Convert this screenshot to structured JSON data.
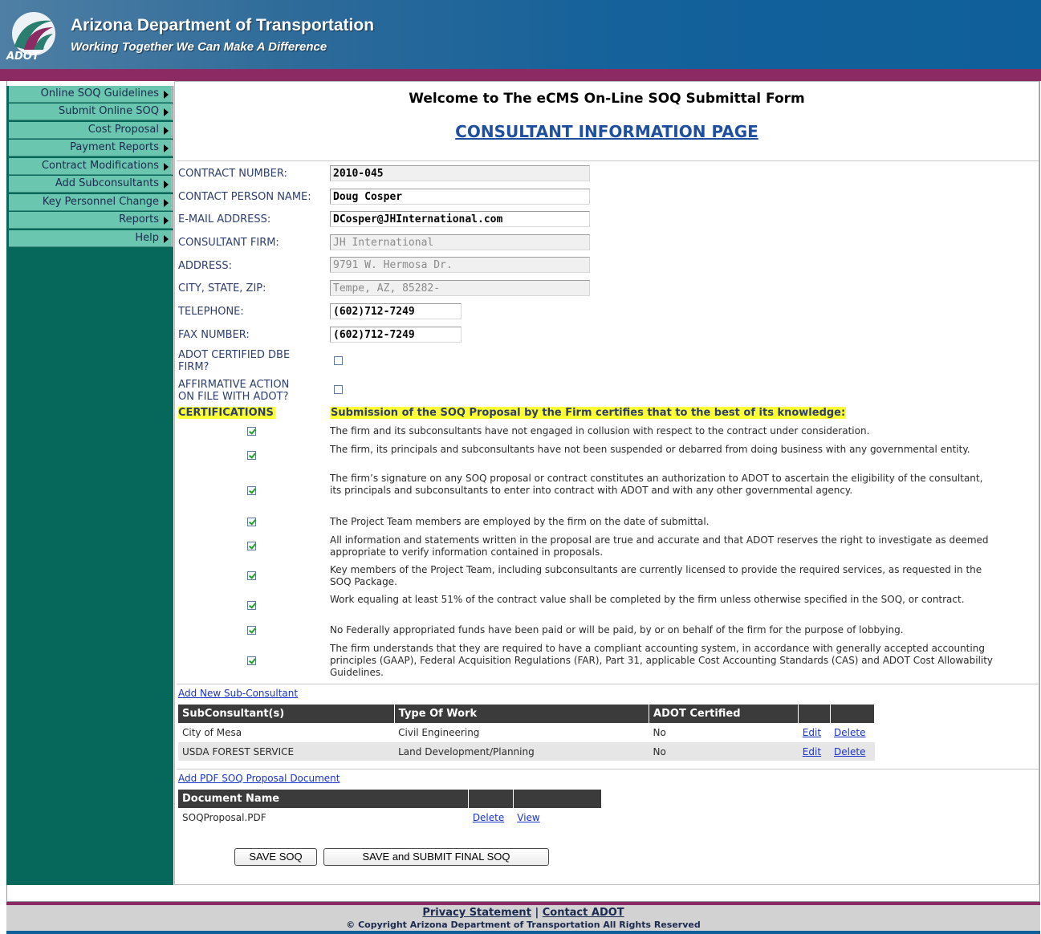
{
  "header": {
    "title": "Arizona Department of Transportation",
    "tagline": "Working Together We Can Make A Difference",
    "logo_text": "ADOT"
  },
  "sidebar": {
    "items": [
      {
        "label": "Online SOQ Guidelines"
      },
      {
        "label": "Submit Online SOQ"
      },
      {
        "label": "Cost Proposal"
      },
      {
        "label": "Payment Reports"
      },
      {
        "label": "Contract Modifications"
      },
      {
        "label": "Add Subconsultants"
      },
      {
        "label": "Key Personnel Change"
      },
      {
        "label": "Reports"
      },
      {
        "label": "Help"
      }
    ]
  },
  "main": {
    "welcome": "Welcome to The eCMS On-Line SOQ Submittal Form",
    "page_title": "CONSULTANT INFORMATION PAGE"
  },
  "form": {
    "contract_number": {
      "label": "CONTRACT NUMBER:",
      "value": "2010-045"
    },
    "contact_person": {
      "label": "CONTACT PERSON NAME:",
      "value": "Doug Cosper"
    },
    "email": {
      "label": "E-MAIL ADDRESS:",
      "value": "DCosper@JHInternational.com"
    },
    "firm": {
      "label": "CONSULTANT FIRM:",
      "value": "JH International"
    },
    "address": {
      "label": "ADDRESS:",
      "value": "9791 W. Hermosa Dr."
    },
    "city_state_zip": {
      "label": "CITY, STATE, ZIP:",
      "value": "Tempe, AZ, 85282-"
    },
    "telephone": {
      "label": "TELEPHONE:",
      "value": "(602)712-7249"
    },
    "fax": {
      "label": "FAX NUMBER:",
      "value": "(602)712-7249"
    },
    "dbe": {
      "label_line1": "ADOT CERTIFIED DBE",
      "label_line2": "FIRM?",
      "checked": false
    },
    "affirmative": {
      "label_line1": "AFFIRMATIVE ACTION",
      "label_line2": "ON FILE WITH ADOT?",
      "checked": false
    }
  },
  "certifications": {
    "label": "CERTIFICATIONS",
    "intro": "Submission of the SOQ Proposal by the Firm certifies that to the best of its knowledge:",
    "items": [
      {
        "text": "The firm and its subconsultants have not engaged in collusion with respect to the contract under consideration.",
        "checked": true
      },
      {
        "text": "The firm, its principals and subconsultants have not been suspended or debarred from doing business with any governmental entity.",
        "checked": true
      },
      {
        "text": "The firm’s signature on any SOQ proposal or contract constitutes an authorization to ADOT to ascertain the eligibility of the consultant, its principals and subconsultants to enter into contract with ADOT and with any other governmental agency.",
        "checked": true
      },
      {
        "text": "The Project Team members are employed by the firm on the date of submittal.",
        "checked": true
      },
      {
        "text": "All information and statements written in the proposal are true and accurate and that ADOT reserves the right to investigate as deemed appropriate to verify information contained in proposals.",
        "checked": true
      },
      {
        "text": "Key members of the Project Team, including subconsultants are currently licensed to provide the required services, as requested in the SOQ Package.",
        "checked": true
      },
      {
        "text": "Work equaling at least 51% of the contract value shall be completed by the firm unless otherwise specified in the SOQ, or contract.",
        "checked": true
      },
      {
        "text": "No Federally appropriated funds have been paid or will be paid, by or on behalf of the firm for the purpose of lobbying.",
        "checked": true
      },
      {
        "text": "The firm understands that they are required to have a compliant accounting system, in accordance with generally accepted accounting principles (GAAP), Federal Acquisition Regulations (FAR), Part 31, applicable Cost Accounting Standards (CAS) and ADOT Cost Allowability Guidelines.",
        "checked": true
      }
    ]
  },
  "subconsultants": {
    "add_link": "Add New Sub-Consultant",
    "headers": [
      "SubConsultant(s)",
      "Type Of Work",
      "ADOT Certified",
      "",
      ""
    ],
    "rows": [
      {
        "name": "City of Mesa",
        "work": "Civil Engineering",
        "certified": "No",
        "edit": "Edit",
        "delete": "Delete"
      },
      {
        "name": "USDA FOREST SERVICE",
        "work": "Land Development/Planning",
        "certified": "No",
        "edit": "Edit",
        "delete": "Delete"
      }
    ]
  },
  "documents": {
    "add_link": "Add PDF SOQ Proposal Document",
    "headers": [
      "Document Name",
      "",
      ""
    ],
    "rows": [
      {
        "name": "SOQProposal.PDF",
        "delete": "Delete",
        "view": "View"
      }
    ]
  },
  "buttons": {
    "save": "SAVE SOQ",
    "submit": "SAVE and SUBMIT FINAL SOQ"
  },
  "footer": {
    "privacy": "Privacy Statement",
    "separator": "|",
    "contact": "Contact ADOT",
    "copyright": "© Copyright Arizona Department of Transportation All Rights Reserved"
  },
  "colors": {
    "header_blue": "#0f5f9a",
    "accent_purple": "#8c2a63",
    "sidebar_green": "#05685b",
    "nav_item": "#6bc6b0",
    "highlight": "#ffff33",
    "link": "#1a33c8"
  }
}
